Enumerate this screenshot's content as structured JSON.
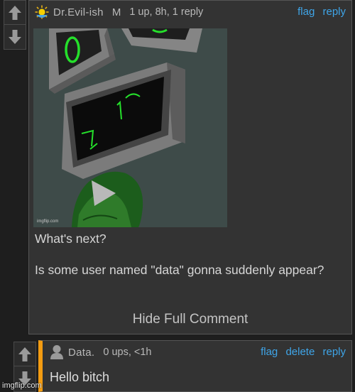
{
  "comment1": {
    "username": "Dr.Evil-ish",
    "mod_badge": "M",
    "meta": "1 up, 8h, 1 reply",
    "actions": {
      "flag": "flag",
      "reply": "reply"
    },
    "user_icon": "sun-icon",
    "image": {
      "watermark": "imgflip.com"
    },
    "text": {
      "line1": "What's next?",
      "line2": "Is some user named \"data\" gonna suddenly appear?"
    },
    "hide_full": "Hide Full Comment"
  },
  "comment2": {
    "username": "Data.",
    "meta": "0 ups, <1h",
    "actions": {
      "flag": "flag",
      "delete": "delete",
      "reply": "reply"
    },
    "user_icon": "user-icon",
    "text": "Hello bitch",
    "accent_color": "#f39c12"
  },
  "watermark": "imgflip.com",
  "colors": {
    "link": "#3fa5e8",
    "background": "#1e1e1e",
    "panel": "#333333"
  }
}
